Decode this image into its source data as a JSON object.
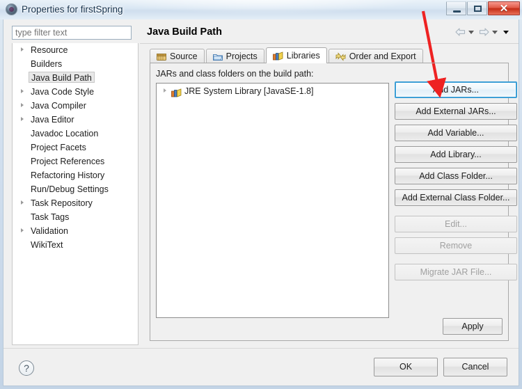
{
  "window": {
    "title": "Properties for firstSpring",
    "app_icon": "eclipse-icon",
    "controls": {
      "minimize": "minimize-button",
      "maximize": "maximize-button",
      "close": "✕"
    }
  },
  "sidebar": {
    "filter": {
      "placeholder": "type filter text",
      "value": ""
    },
    "items": [
      {
        "label": "Resource",
        "expandable": true,
        "selected": false
      },
      {
        "label": "Builders",
        "expandable": false,
        "selected": false
      },
      {
        "label": "Java Build Path",
        "expandable": false,
        "selected": true
      },
      {
        "label": "Java Code Style",
        "expandable": true,
        "selected": false
      },
      {
        "label": "Java Compiler",
        "expandable": true,
        "selected": false
      },
      {
        "label": "Java Editor",
        "expandable": true,
        "selected": false
      },
      {
        "label": "Javadoc Location",
        "expandable": false,
        "selected": false
      },
      {
        "label": "Project Facets",
        "expandable": false,
        "selected": false
      },
      {
        "label": "Project References",
        "expandable": false,
        "selected": false
      },
      {
        "label": "Refactoring History",
        "expandable": false,
        "selected": false
      },
      {
        "label": "Run/Debug Settings",
        "expandable": false,
        "selected": false
      },
      {
        "label": "Task Repository",
        "expandable": true,
        "selected": false
      },
      {
        "label": "Task Tags",
        "expandable": false,
        "selected": false
      },
      {
        "label": "Validation",
        "expandable": true,
        "selected": false
      },
      {
        "label": "WikiText",
        "expandable": false,
        "selected": false
      }
    ]
  },
  "pane": {
    "title": "Java Build Path",
    "nav": {
      "back": "back-arrow-icon",
      "back_menu": "back-dropdown-icon",
      "forward": "forward-arrow-icon",
      "forward_menu": "forward-dropdown-icon",
      "menu": "view-menu-icon"
    },
    "tabs": [
      {
        "label": "Source",
        "icon": "source-folder-icon",
        "active": false
      },
      {
        "label": "Projects",
        "icon": "projects-folder-icon",
        "active": false
      },
      {
        "label": "Libraries",
        "icon": "libraries-books-icon",
        "active": true
      },
      {
        "label": "Order and Export",
        "icon": "order-export-icon",
        "active": false
      }
    ],
    "list_label": "JARs and class folders on the build path:",
    "entries": [
      {
        "label": "JRE System Library [JavaSE-1.8]",
        "icon": "jre-library-icon",
        "expandable": true
      }
    ],
    "buttons": [
      {
        "label": "Add JARs...",
        "state": "focused"
      },
      {
        "label": "Add External JARs...",
        "state": "normal"
      },
      {
        "label": "Add Variable...",
        "state": "normal"
      },
      {
        "label": "Add Library...",
        "state": "normal"
      },
      {
        "label": "Add Class Folder...",
        "state": "normal"
      },
      {
        "label": "Add External Class Folder...",
        "state": "normal"
      },
      {
        "label": "Edit...",
        "state": "disabled",
        "group_gap": true
      },
      {
        "label": "Remove",
        "state": "disabled"
      },
      {
        "label": "Migrate JAR File...",
        "state": "disabled",
        "group_gap": true
      }
    ],
    "apply_label": "Apply"
  },
  "footer": {
    "help_icon": "?",
    "ok_label": "OK",
    "cancel_label": "Cancel"
  },
  "annotation": {
    "type": "red-arrow",
    "color": "#ee2222",
    "points_to": "Add JARs..."
  }
}
